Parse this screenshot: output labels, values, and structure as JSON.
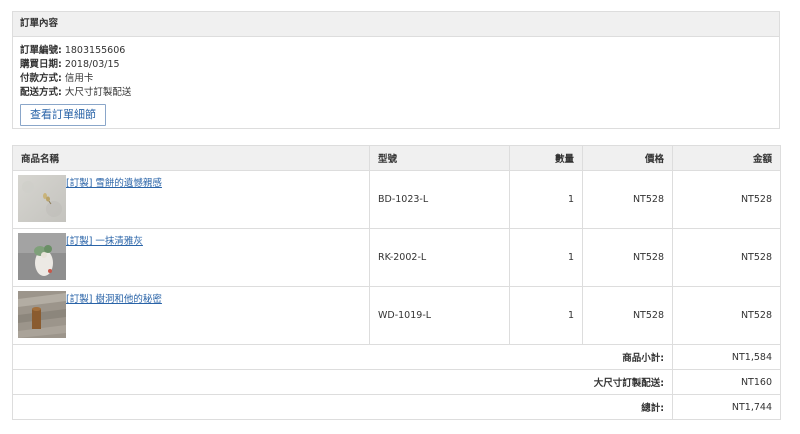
{
  "order_panel": {
    "title": "訂單內容",
    "lines": [
      {
        "label": "訂單編號:",
        "value": "1803155606"
      },
      {
        "label": "購買日期:",
        "value": "2018/03/15"
      },
      {
        "label": "付款方式:",
        "value": "信用卡"
      },
      {
        "label": "配送方式:",
        "value": "大尺寸訂製配送"
      }
    ],
    "details_button": "查看訂單細節"
  },
  "items_table": {
    "headers": {
      "name": "商品名稱",
      "model": "型號",
      "qty": "數量",
      "price": "價格",
      "amount": "金額"
    },
    "rows": [
      {
        "name": "[訂製] 雪餅的遺憾親感",
        "model": "BD-1023-L",
        "qty": "1",
        "price": "NT528",
        "amount": "NT528",
        "thumb": "thumb-white-wall-dried-flower"
      },
      {
        "name": "[訂製] 一抹清雅灰",
        "model": "RK-2002-L",
        "qty": "1",
        "price": "NT528",
        "amount": "NT528",
        "thumb": "thumb-white-bouquet"
      },
      {
        "name": "[訂製] 樹洞和他的秘密",
        "model": "WD-1019-L",
        "qty": "1",
        "price": "NT528",
        "amount": "NT528",
        "thumb": "thumb-wood-floor"
      }
    ],
    "summary": [
      {
        "label": "商品小計:",
        "value": "NT1,584"
      },
      {
        "label": "大尺寸訂製配送:",
        "value": "NT160"
      },
      {
        "label": "總計:",
        "value": "NT1,744"
      }
    ]
  }
}
